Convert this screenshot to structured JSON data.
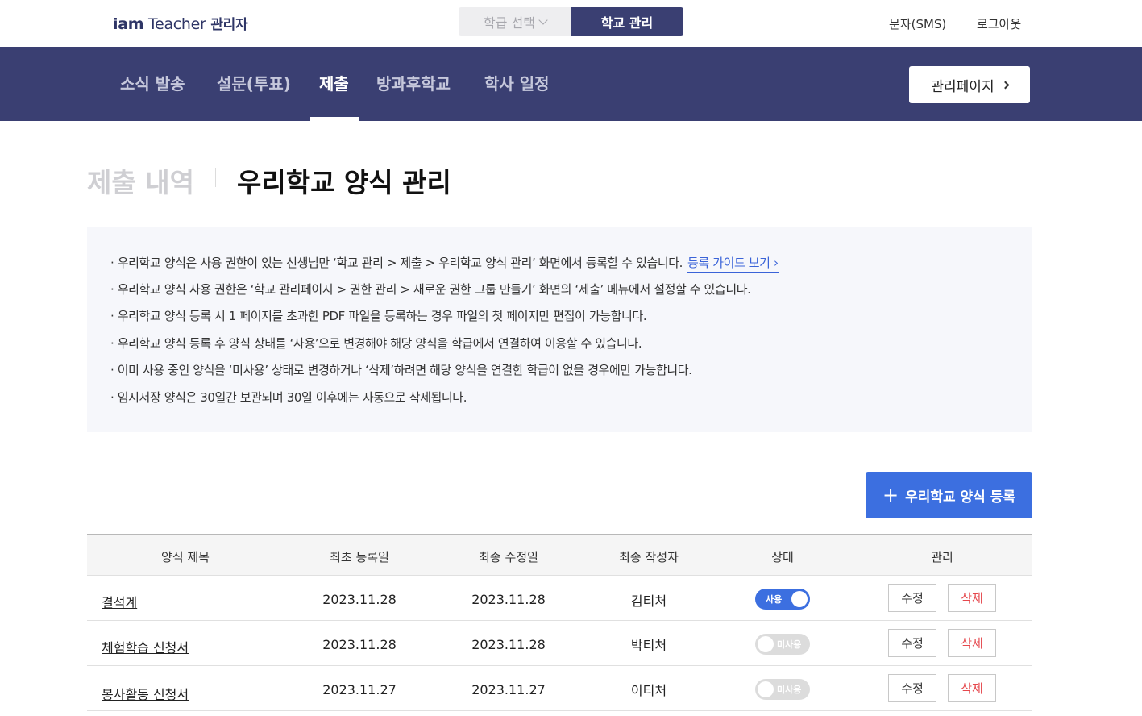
{
  "topbar": {
    "brand_part1": "iam",
    "brand_part2": " Teacher ",
    "brand_part3": "관리자",
    "class_select": "학급 선택",
    "school_mgmt": "학교 관리",
    "sms": "문자(SMS)",
    "logout": "로그아웃"
  },
  "nav": {
    "items": [
      "소식 발송",
      "설문(투표)",
      "제출",
      "방과후학교",
      "학사 일정"
    ],
    "active_index": 2,
    "admin_page": "관리페이지"
  },
  "page": {
    "title_inactive": "제출 내역",
    "title_active": "우리학교 양식 관리"
  },
  "notice": {
    "lines": [
      "· 우리학교 양식은 사용 권한이 있는 선생님만 ‘학교 관리 > 제출 > 우리학교 양식 관리’ 화면에서 등록할 수 있습니다.",
      "· 우리학교 양식 사용 권한은 ‘학교 관리페이지 > 권한 관리 > 새로운 권한 그룹 만들기’ 화면의 ‘제출’ 메뉴에서 설정할 수 있습니다.",
      "· 우리학교 양식 등록 시 1 페이지를 초과한 PDF 파일을 등록하는 경우 파일의 첫 페이지만 편집이 가능합니다.",
      "· 우리학교 양식 등록 후 양식 상태를 ‘사용’으로 변경해야 해당 양식을 학급에서 연결하여 이용할 수 있습니다.",
      "· 이미 사용 중인 양식을 ‘미사용’ 상태로 변경하거나 ‘삭제’하려면 해당 양식을 연결한 학급이 없을 경우에만 가능합니다.",
      "· 임시저장 양식은 30일간 보관되며 30일 이후에는 자동으로 삭제됩니다."
    ],
    "guide_link": "등록 가이드 보기 ›"
  },
  "register_button": "우리학교 양식 등록",
  "table": {
    "headers": [
      "양식 제목",
      "최초 등록일",
      "최종 수정일",
      "최종 작성자",
      "상태",
      "관리"
    ],
    "rows": [
      {
        "title": "결석계",
        "created": "2023.11.28",
        "modified": "2023.11.28",
        "author": "김티처",
        "status_label": "사용",
        "enabled": true
      },
      {
        "title": "체험학습 신청서",
        "created": "2023.11.28",
        "modified": "2023.11.28",
        "author": "박티처",
        "status_label": "미사용",
        "enabled": false
      },
      {
        "title": "봉사활동 신청서",
        "created": "2023.11.27",
        "modified": "2023.11.27",
        "author": "이티처",
        "status_label": "미사용",
        "enabled": false
      }
    ],
    "edit_label": "수정",
    "delete_label": "삭제"
  },
  "colors": {
    "navy": "#3a3f72",
    "accent_blue": "#3c6fe0",
    "delete_red": "#e5484d"
  }
}
